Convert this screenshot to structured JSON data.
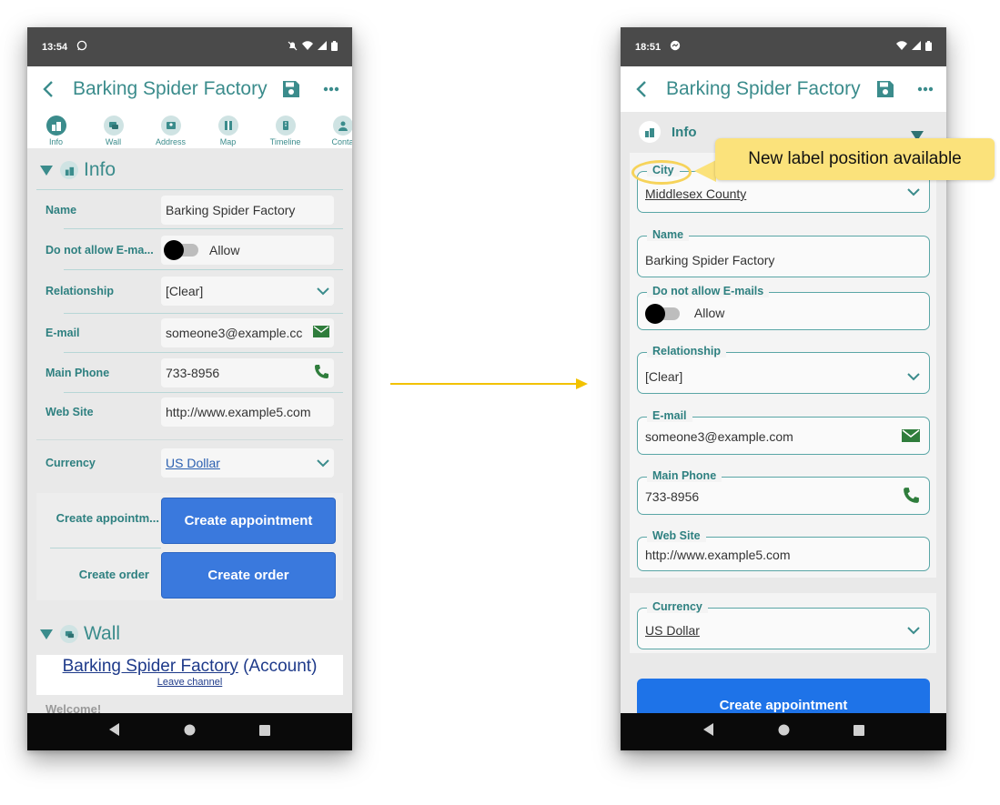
{
  "left": {
    "status": {
      "time": "13:54"
    },
    "title": "Barking Spider Factory",
    "tabs": [
      {
        "label": "Info",
        "icon": "building-icon"
      },
      {
        "label": "Wall",
        "icon": "chat-icon"
      },
      {
        "label": "Address",
        "icon": "contact-card-icon"
      },
      {
        "label": "Map",
        "icon": "map-icon"
      },
      {
        "label": "Timeline",
        "icon": "timeline-icon"
      },
      {
        "label": "Conta",
        "icon": "person-icon"
      }
    ],
    "info_title": "Info",
    "fields": {
      "name_label": "Name",
      "name_value": "Barking Spider Factory",
      "email_optout_label": "Do not allow E-ma...",
      "email_optout_value": "Allow",
      "relationship_label": "Relationship",
      "relationship_value": "[Clear]",
      "email_label": "E-mail",
      "email_value": "someone3@example.cc",
      "phone_label": "Main Phone",
      "phone_value": "733-8956",
      "website_label": "Web Site",
      "website_value": "http://www.example5.com",
      "currency_label": "Currency",
      "currency_value": "US Dollar"
    },
    "actions": {
      "appt_label": "Create appointm...",
      "appt_button": "Create appointment",
      "order_label": "Create order",
      "order_button": "Create order"
    },
    "wall_title": "Wall",
    "wall": {
      "account_link": "Barking Spider Factory",
      "account_suffix": "(Account)",
      "leave_channel": "Leave channel",
      "welcome": "Welcome!"
    }
  },
  "right": {
    "status": {
      "time": "18:51"
    },
    "title": "Barking Spider Factory",
    "info_title": "Info",
    "fields": {
      "city_label": "City",
      "city_value": "Middlesex County",
      "name_label": "Name",
      "name_value": "Barking Spider Factory",
      "email_optout_label": "Do not allow E-mails",
      "email_optout_value": "Allow",
      "relationship_label": "Relationship",
      "relationship_value": "[Clear]",
      "email_label": "E-mail",
      "email_value": "someone3@example.com",
      "phone_label": "Main Phone",
      "phone_value": "733-8956",
      "website_label": "Web Site",
      "website_value": "http://www.example5.com",
      "currency_label": "Currency",
      "currency_value": "US Dollar"
    },
    "appt_button": "Create appointment"
  },
  "annotation": {
    "callout_text": "New label position available"
  },
  "colors": {
    "teal": "#3b8c8c",
    "blue": "#3a79dd",
    "highlight": "#fbe27b",
    "arrow": "#f2c200"
  }
}
